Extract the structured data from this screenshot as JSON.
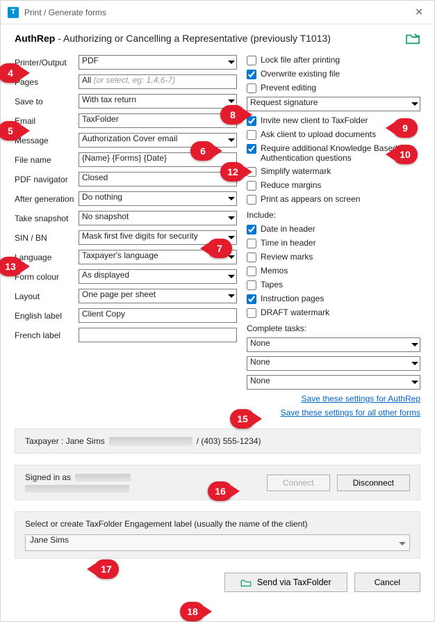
{
  "window": {
    "title": "Print / Generate forms"
  },
  "header": {
    "bold": "AuthRep",
    "rest": " - Authorizing or Cancelling a Representative (previously T1013)"
  },
  "form": {
    "printer_output": {
      "label": "Printer/Output",
      "value": "PDF"
    },
    "pages": {
      "label": "Pages",
      "value": "All",
      "placeholder": " (or select, eg: 1,4,6-7)"
    },
    "save_to": {
      "label": "Save to",
      "value": "With tax return"
    },
    "email": {
      "label": "Email",
      "value": "TaxFolder"
    },
    "message": {
      "label": "Message",
      "value": "Authorization Cover email"
    },
    "file_name": {
      "label": "File name",
      "value": "{Name} {Forms} {Date}"
    },
    "pdf_navigator": {
      "label": "PDF navigator",
      "value": "Closed"
    },
    "after_generation": {
      "label": "After generation",
      "value": "Do nothing"
    },
    "take_snapshot": {
      "label": "Take snapshot",
      "value": "No snapshot"
    },
    "sin_bn": {
      "label": "SIN / BN",
      "value": "Mask first five digits for security"
    },
    "language": {
      "label": "Language",
      "value": "Taxpayer's language"
    },
    "form_colour": {
      "label": "Form colour",
      "value": "As displayed"
    },
    "layout": {
      "label": "Layout",
      "value": "One page per sheet"
    },
    "english_label": {
      "label": "English label",
      "value": "Client Copy"
    },
    "french_label": {
      "label": "French label",
      "value": ""
    }
  },
  "checkboxes": {
    "lock_file": {
      "label": "Lock file after printing",
      "checked": false
    },
    "overwrite": {
      "label": "Overwrite existing file",
      "checked": true
    },
    "prevent_editing": {
      "label": "Prevent editing",
      "checked": false
    },
    "request_signature": {
      "label": "Request signature",
      "is_select": true
    },
    "invite_new_client": {
      "label": "Invite new client to TaxFolder",
      "checked": true
    },
    "ask_upload": {
      "label": "Ask client to upload documents",
      "checked": false
    },
    "require_kba": {
      "label": "Require additional Knowledge Based Authentication questions",
      "checked": true
    },
    "simplify_watermark": {
      "label": "Simplify watermark",
      "checked": false
    },
    "reduce_margins": {
      "label": "Reduce margins",
      "checked": false
    },
    "print_as_appears": {
      "label": "Print as appears on screen",
      "checked": false
    }
  },
  "include": {
    "heading": "Include:",
    "date_in_header": {
      "label": "Date in header",
      "checked": true
    },
    "time_in_header": {
      "label": "Time in header",
      "checked": false
    },
    "review_marks": {
      "label": "Review marks",
      "checked": false
    },
    "memos": {
      "label": "Memos",
      "checked": false
    },
    "tapes": {
      "label": "Tapes",
      "checked": false
    },
    "instruction_pages": {
      "label": "Instruction pages",
      "checked": true
    },
    "draft_watermark": {
      "label": "DRAFT watermark",
      "checked": false
    }
  },
  "complete_tasks": {
    "heading": "Complete tasks:",
    "opt1": "None",
    "opt2": "None",
    "opt3": "None"
  },
  "links": {
    "save_authrep": "Save these settings for AuthRep",
    "save_other": "Save these settings for all other forms"
  },
  "taxpayer": {
    "prefix": "Taxpayer  :  Jane Sims",
    "phone": " / (403) 555-1234)"
  },
  "signin": {
    "label": "Signed in as",
    "connect": "Connect",
    "disconnect": "Disconnect"
  },
  "engagement": {
    "label": "Select or create TaxFolder Engagement label (usually the name of the client)",
    "value": "Jane Sims"
  },
  "footer": {
    "send": "Send via TaxFolder",
    "cancel": "Cancel"
  },
  "callouts": {
    "c4": "4",
    "c5": "5",
    "c6": "6",
    "c7": "7",
    "c8": "8",
    "c9": "9",
    "c10": "10",
    "c12": "12",
    "c13": "13",
    "c15": "15",
    "c16": "16",
    "c17": "17",
    "c18": "18"
  }
}
